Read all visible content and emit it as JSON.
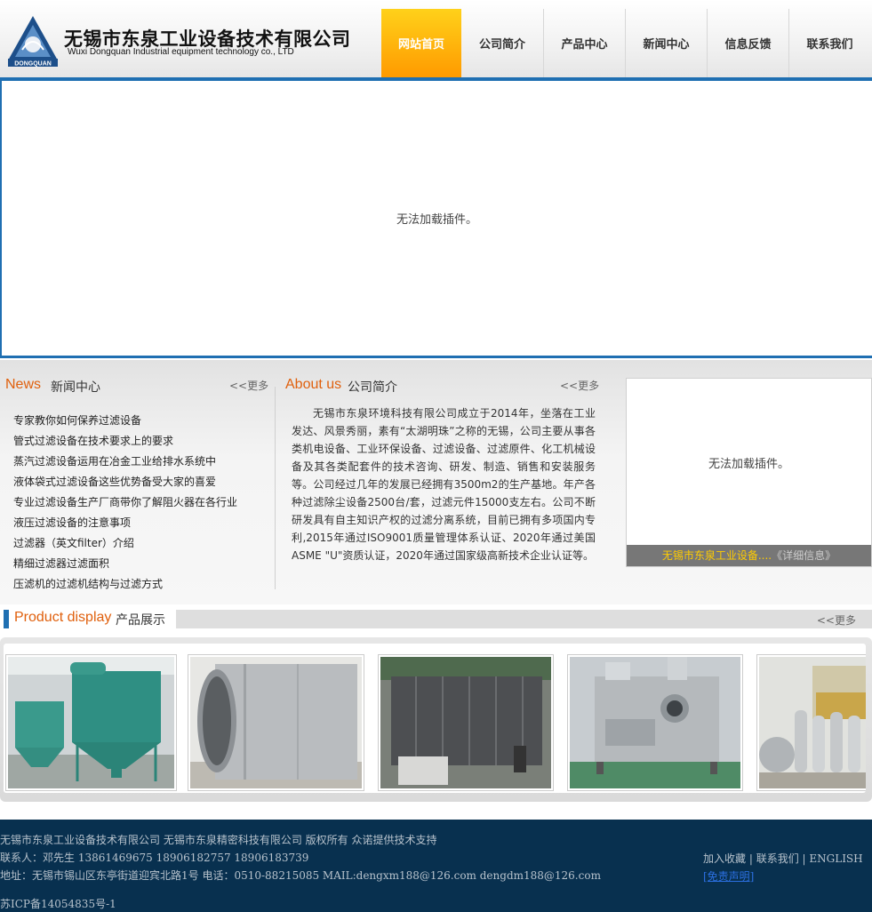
{
  "header": {
    "logo_text": "DONGQUAN",
    "company_cn": "无锡市东泉工业设备技术有限公司",
    "company_en": "Wuxi Dongquan Industrial equipment technology co., LTD",
    "nav": [
      "网站首页",
      "公司简介",
      "产品中心",
      "新闻中心",
      "信息反馈",
      "联系我们"
    ]
  },
  "banner": {
    "plugin_message": "无法加载插件。"
  },
  "news": {
    "title_en": "News",
    "title_cn": "新闻中心",
    "more": "<<更多",
    "items": [
      "专家教你如何保养过滤设备",
      "管式过滤设备在技术要求上的要求",
      "蒸汽过滤设备运用在冶金工业给排水系统中",
      "液体袋式过滤设备这些优势备受大家的喜爱",
      "专业过滤设备生产厂商带你了解阻火器在各行业",
      "液压过滤设备的注意事项",
      "过滤器（英文filter）介绍",
      "精细过滤器过滤面积",
      "压滤机的过滤机结构与过滤方式"
    ]
  },
  "about": {
    "title_en": "About us",
    "title_cn": "公司简介",
    "more": "<<更多",
    "text": "无锡市东泉环境科技有限公司成立于2014年，坐落在工业发达、风景秀丽，素有“太湖明珠”之称的无锡，公司主要从事各类机电设备、工业环保设备、过滤设备、过滤原件、化工机械设备及其各类配套件的技术咨询、研发、制造、销售和安装服务等。公司经过几年的发展已经拥有3500m2的生产基地。年产各种过滤除尘设备2500台/套，过滤元件15000支左右。公司不断研发具有自主知识产权的过滤分离系统，目前已拥有多项国内专利,2015年通过ISO9001质量管理体系认证、2020年通过美国ASME \"U\"资质认证，2020年通过国家级高新技术企业认证等。"
  },
  "side": {
    "plugin_message": "无法加载插件。",
    "caption_title": "无锡市东泉工业设备....",
    "caption_detail": "《详细信息》"
  },
  "products": {
    "title_en": "Product display",
    "title_cn": "产品展示",
    "more": "<<更多"
  },
  "footer": {
    "line1": "无锡市东泉工业设备技术有限公司  无锡市东泉精密科技有限公司  版权所有 众诺提供技术支持",
    "line2": "联系人：邓先生 13861469675 18906182757 18906183739",
    "line3": "地址：无锡市锡山区东亭街道迎宾北路1号 电话：0510-88215085 MAIL:dengxm188@126.com dengdm188@126.com",
    "line4": "苏ICP备14054835号-1",
    "links": [
      "加入收藏",
      "联系我们",
      "ENGLISH",
      "[免责声明]"
    ]
  },
  "colors": {
    "accent_blue": "#1f6fb2",
    "nav_active": "#ff9a00",
    "title_orange": "#e0600d",
    "footer_bg": "#08304f"
  }
}
